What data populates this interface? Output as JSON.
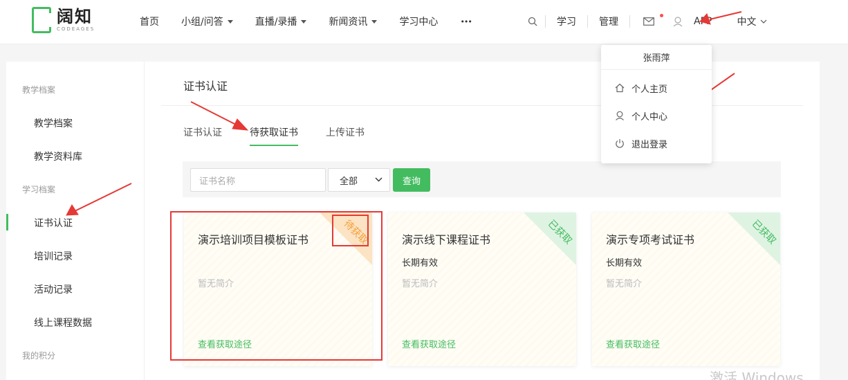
{
  "logo": {
    "cn": "阔知",
    "en": "CODEAGES"
  },
  "nav": [
    {
      "label": "首页"
    },
    {
      "label": "小组/问答"
    },
    {
      "label": "直播/录播"
    },
    {
      "label": "新闻资讯"
    },
    {
      "label": "学习中心"
    },
    {
      "label": "•••"
    }
  ],
  "right_nav": {
    "study": "学习",
    "manage": "管理",
    "app": "APP",
    "lang": "中文"
  },
  "dropdown": {
    "user_name": "张雨萍",
    "items": [
      {
        "label": "个人主页"
      },
      {
        "label": "个人中心"
      },
      {
        "label": "退出登录"
      }
    ]
  },
  "sidebar": {
    "group1": "教学档案",
    "item1": "教学档案",
    "item2": "教学资料库",
    "group2": "学习档案",
    "item3": "证书认证",
    "item4": "培训记录",
    "item5": "活动记录",
    "item6": "线上课程数据",
    "group3": "我的积分"
  },
  "page": {
    "title": "证书认证",
    "tabs": [
      {
        "label": "证书认证"
      },
      {
        "label": "待获取证书"
      },
      {
        "label": "上传证书"
      }
    ],
    "search": {
      "placeholder": "证书名称",
      "select": "全部",
      "button": "查询"
    }
  },
  "cards": [
    {
      "title": "演示培训项目模板证书",
      "validity": "",
      "desc": "暂无简介",
      "link": "查看获取途径",
      "status": "待获取",
      "status_color": "#f5a03a"
    },
    {
      "title": "演示线下课程证书",
      "validity": "长期有效",
      "desc": "暂无简介",
      "link": "查看获取途径",
      "status": "已获取",
      "status_color": "#43bc60"
    },
    {
      "title": "演示专项考试证书",
      "validity": "长期有效",
      "desc": "暂无简介",
      "link": "查看获取途径",
      "status": "已获取",
      "status_color": "#43bc60"
    }
  ],
  "watermark": "激活 Windows",
  "colors": {
    "accent": "#43bc60",
    "annotation": "#e53935"
  }
}
